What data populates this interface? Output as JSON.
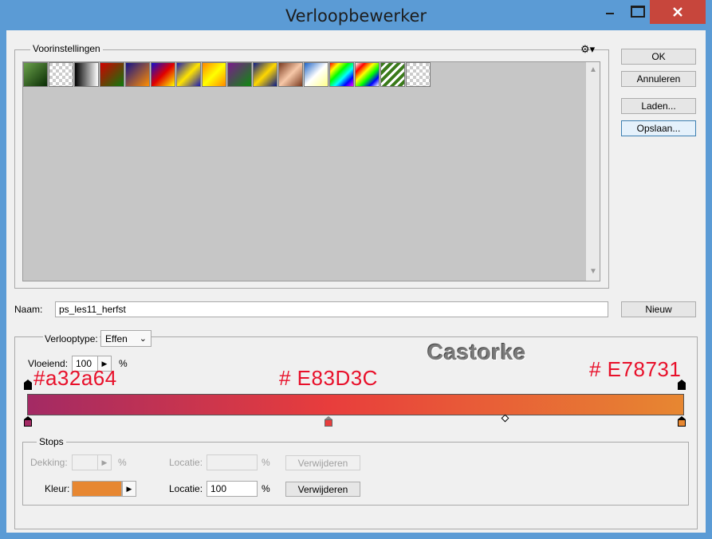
{
  "window": {
    "title": "Verloopbewerker",
    "controls": {
      "minimize_icon": "minimize-icon",
      "maximize_icon": "maximize-icon",
      "close_icon": "close-icon"
    }
  },
  "presets": {
    "label": "Voorinstellingen",
    "menu_icon": "gear-icon",
    "swatches": [
      "linear-gradient(135deg,#6aa14a,#0a2d05)",
      "repeating-conic-gradient(#fff 0 25%,#ccc 0 50%) 0 0/8px 8px",
      "linear-gradient(90deg,#000,#fff)",
      "linear-gradient(135deg,#d10000,#0c7a0c)",
      "linear-gradient(135deg,#14148a,#ff8c00)",
      "linear-gradient(135deg,#1010d0,#e00000,#ffff00)",
      "linear-gradient(135deg,#1c1cb4,#ffe400,#1c1cb4)",
      "linear-gradient(135deg,#ff8800,#ffff00,#ff8800)",
      "linear-gradient(135deg,#7a1b8c,#0f8a0f)",
      "linear-gradient(135deg,#0a1a8a,#ffd700,#0a1a8a)",
      "linear-gradient(135deg,#7a3a20,#f7c8a8,#7a3a20)",
      "linear-gradient(135deg,#1e64c8,#ffffff,#ffff88)",
      "linear-gradient(135deg,#ff0000,#ffff00,#00ff00,#00ffff,#0000ff,#ff00ff)",
      "linear-gradient(135deg,#ffffff,#ff0000,#ffff00,#00ff00,#0000ff,#ffffff)",
      "repeating-linear-gradient(135deg,#3a7a1a 0 4px,#ffffff 4px 7px)",
      "repeating-conic-gradient(#fff 0 25%,#ccc 0 50%) 0 0/8px 8px"
    ]
  },
  "buttons": {
    "ok": "OK",
    "cancel": "Annuleren",
    "load": "Laden...",
    "save": "Opslaan...",
    "new": "Nieuw"
  },
  "name": {
    "label": "Naam:",
    "value": "ps_les11_herfst"
  },
  "gradient": {
    "type_label": "Verlooptype:",
    "type_value": "Effen",
    "smoothness_label": "Vloeiend:",
    "smoothness_value": "100",
    "percent": "%",
    "watermark": "Castorke",
    "annotations": [
      "#a32a64",
      "# E83D3C",
      "# E78731"
    ],
    "colors": [
      "#a32a64",
      "#e83d3c",
      "#e78731"
    ]
  },
  "stops": {
    "label": "Stops",
    "opacity_label": "Dekking:",
    "location_label": "Locatie:",
    "delete_label": "Verwijderen",
    "color_label": "Kleur:",
    "location_value": "100",
    "percent": "%",
    "color_value": "#e78731"
  }
}
